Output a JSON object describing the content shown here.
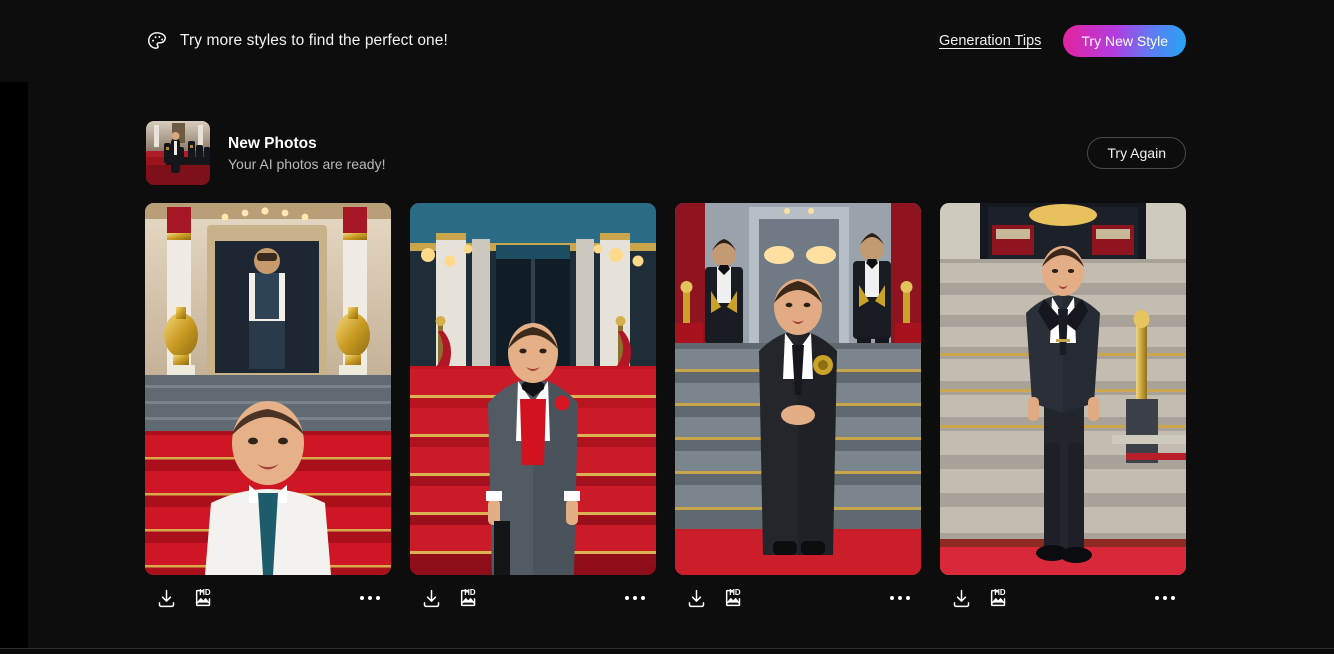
{
  "banner": {
    "icon": "palette-icon",
    "message": "Try more styles to find the perfect one!",
    "tips_link": "Generation Tips",
    "cta_label": "Try New Style",
    "cta_gradient_from": "#e4229b",
    "cta_gradient_to": "#23a6f3"
  },
  "result_header": {
    "thumbnail_alt": "red-carpet-ceremony-thumbnail",
    "title": "New Photos",
    "subtitle": "Your AI photos are ready!",
    "retry_label": "Try Again"
  },
  "gallery": {
    "photos": [
      {
        "alt": "child in white shirt and teal tie standing on red carpet steps with guard and golden urns",
        "download_icon": "download-icon",
        "hd_icon": "hd-image-icon",
        "more_icon": "more-options-icon"
      },
      {
        "alt": "child in grey tuxedo with red vest and black bow tie on red staircase",
        "download_icon": "download-icon",
        "hd_icon": "hd-image-icon",
        "more_icon": "more-options-icon"
      },
      {
        "alt": "child in dark suit with gold emblem flanked by two attendants on grand steps",
        "download_icon": "download-icon",
        "hd_icon": "hd-image-icon",
        "more_icon": "more-options-icon"
      },
      {
        "alt": "child in dark suit descending stone steps beside golden stanchion",
        "download_icon": "download-icon",
        "hd_icon": "hd-image-icon",
        "more_icon": "more-options-icon"
      }
    ],
    "hd_badge_text": "HD"
  }
}
